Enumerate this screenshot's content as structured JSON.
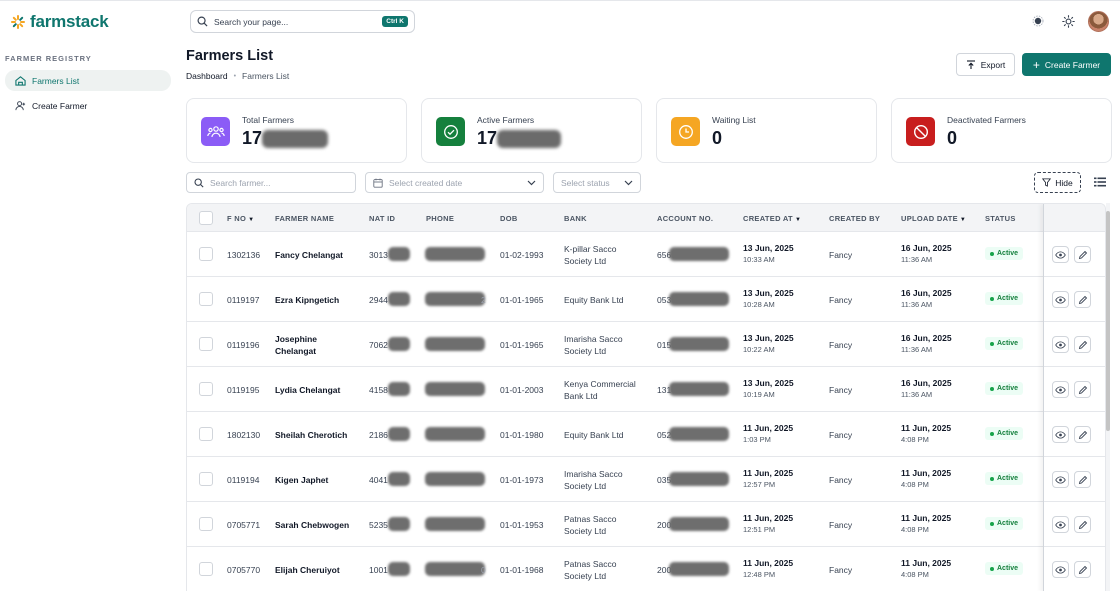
{
  "brand": {
    "name": "farmstack",
    "accent": "#0f766e"
  },
  "sidebar": {
    "section": "FARMER REGISTRY",
    "items": [
      {
        "label": "Farmers List",
        "active": true
      },
      {
        "label": "Create Farmer",
        "active": false
      }
    ]
  },
  "search": {
    "placeholder": "Search your page...",
    "shortcut": "Ctrl K"
  },
  "header": {
    "title": "Farmers List",
    "breadcrumb": [
      "Dashboard",
      "Farmers List"
    ],
    "export_label": "Export",
    "create_label": "Create Farmer"
  },
  "stats": [
    {
      "label": "Total Farmers",
      "value": "17",
      "color": "#8b5cf6"
    },
    {
      "label": "Active Farmers",
      "value": "17",
      "color": "#15803d"
    },
    {
      "label": "Waiting List",
      "value": "0",
      "color": "#f5a623"
    },
    {
      "label": "Deactivated Farmers",
      "value": "0",
      "color": "#c81e1e"
    }
  ],
  "filters": {
    "search_placeholder": "Search farmer...",
    "date_placeholder": "Select created date",
    "status_placeholder": "Select status",
    "hide_label": "Hide"
  },
  "table": {
    "columns": [
      "F NO",
      "FARMER NAME",
      "NAT ID",
      "PHONE",
      "DOB",
      "BANK",
      "ACCOUNT NO.",
      "CREATED AT",
      "CREATED BY",
      "UPLOAD DATE",
      "STATUS"
    ],
    "rows": [
      {
        "fno": "1302136",
        "name": [
          "Fancy Chelangat"
        ],
        "natid": "3013",
        "phone": "",
        "dob": "01-02-1993",
        "bank": [
          "K-pillar Sacco",
          "Society Ltd"
        ],
        "acct": "656",
        "created_date": "13 Jun, 2025",
        "created_time": "10:33 AM",
        "created_by": "Fancy",
        "upload_date": "16 Jun, 2025",
        "upload_time": "11:36 AM",
        "status": "Active"
      },
      {
        "fno": "0119197",
        "name": [
          "Ezra Kipngetich"
        ],
        "natid": "2944",
        "phone": "2",
        "dob": "01-01-1965",
        "bank": [
          "Equity Bank Ltd"
        ],
        "acct": "053",
        "created_date": "13 Jun, 2025",
        "created_time": "10:28 AM",
        "created_by": "Fancy",
        "upload_date": "16 Jun, 2025",
        "upload_time": "11:36 AM",
        "status": "Active"
      },
      {
        "fno": "0119196",
        "name": [
          "Josephine",
          "Chelangat"
        ],
        "natid": "7062",
        "phone": "",
        "dob": "01-01-1965",
        "bank": [
          "Imarisha Sacco",
          "Society Ltd"
        ],
        "acct": "015",
        "created_date": "13 Jun, 2025",
        "created_time": "10:22 AM",
        "created_by": "Fancy",
        "upload_date": "16 Jun, 2025",
        "upload_time": "11:36 AM",
        "status": "Active"
      },
      {
        "fno": "0119195",
        "name": [
          "Lydia Chelangat"
        ],
        "natid": "4158",
        "phone": "",
        "dob": "01-01-2003",
        "bank": [
          "Kenya Commercial",
          "Bank Ltd"
        ],
        "acct": "131",
        "created_date": "13 Jun, 2025",
        "created_time": "10:19 AM",
        "created_by": "Fancy",
        "upload_date": "16 Jun, 2025",
        "upload_time": "11:36 AM",
        "status": "Active"
      },
      {
        "fno": "1802130",
        "name": [
          "Sheilah Cherotich"
        ],
        "natid": "2186",
        "phone": "",
        "dob": "01-01-1980",
        "bank": [
          "Equity Bank Ltd"
        ],
        "acct": "052",
        "created_date": "11 Jun, 2025",
        "created_time": "1:03 PM",
        "created_by": "Fancy",
        "upload_date": "11 Jun, 2025",
        "upload_time": "4:08 PM",
        "status": "Active"
      },
      {
        "fno": "0119194",
        "name": [
          "Kigen Japhet"
        ],
        "natid": "4041",
        "phone": "",
        "dob": "01-01-1973",
        "bank": [
          "Imarisha Sacco",
          "Society Ltd"
        ],
        "acct": "035",
        "created_date": "11 Jun, 2025",
        "created_time": "12:57 PM",
        "created_by": "Fancy",
        "upload_date": "11 Jun, 2025",
        "upload_time": "4:08 PM",
        "status": "Active"
      },
      {
        "fno": "0705771",
        "name": [
          "Sarah Chebwogen"
        ],
        "natid": "5235",
        "phone": "",
        "dob": "01-01-1953",
        "bank": [
          "Patnas Sacco",
          "Society Ltd"
        ],
        "acct": "200",
        "created_date": "11 Jun, 2025",
        "created_time": "12:51 PM",
        "created_by": "Fancy",
        "upload_date": "11 Jun, 2025",
        "upload_time": "4:08 PM",
        "status": "Active"
      },
      {
        "fno": "0705770",
        "name": [
          "Elijah Cheruiyot"
        ],
        "natid": "1001",
        "phone": "0",
        "dob": "01-01-1968",
        "bank": [
          "Patnas Sacco",
          "Society Ltd"
        ],
        "acct": "200",
        "created_date": "11 Jun, 2025",
        "created_time": "12:48 PM",
        "created_by": "Fancy",
        "upload_date": "11 Jun, 2025",
        "upload_time": "4:08 PM",
        "status": "Active"
      }
    ]
  }
}
